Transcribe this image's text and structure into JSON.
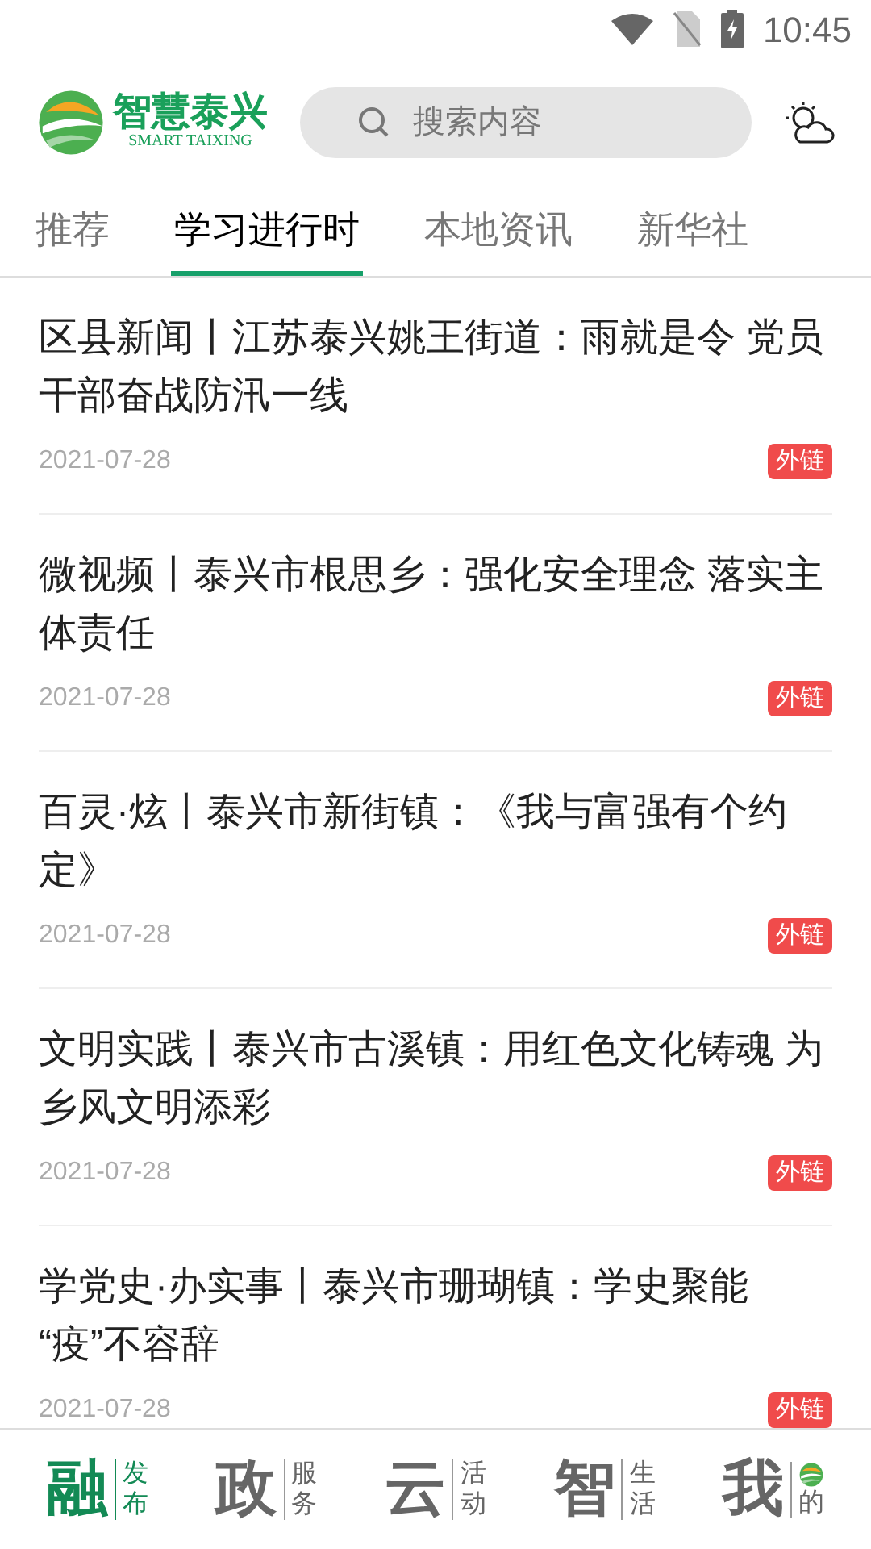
{
  "status_bar": {
    "time": "10:45"
  },
  "header": {
    "logo": {
      "title": "智慧泰兴",
      "subtitle": "SMART TAIXING"
    },
    "search": {
      "placeholder": "搜索内容"
    }
  },
  "tabs": [
    {
      "label": "推荐",
      "selected": false
    },
    {
      "label": "学习进行时",
      "selected": true
    },
    {
      "label": "本地资讯",
      "selected": false
    },
    {
      "label": "新华社",
      "selected": false
    }
  ],
  "articles": [
    {
      "title": "区县新闻丨江苏泰兴姚王街道：雨就是令 党员干部奋战防汛一线",
      "date": "2021-07-28",
      "badge": "外链"
    },
    {
      "title": "微视频丨泰兴市根思乡：强化安全理念 落实主体责任",
      "date": "2021-07-28",
      "badge": "外链"
    },
    {
      "title": "百灵·炫丨泰兴市新街镇：《我与富强有个约定》",
      "date": "2021-07-28",
      "badge": "外链"
    },
    {
      "title": "文明实践丨泰兴市古溪镇：用红色文化铸魂  为乡风文明添彩",
      "date": "2021-07-28",
      "badge": "外链"
    },
    {
      "title": "学党史·办实事丨泰兴市珊瑚镇：学史聚能 “疫”不容辞",
      "date": "2021-07-28",
      "badge": "外链"
    }
  ],
  "bottom_nav": [
    {
      "big": "融",
      "small": "发布",
      "selected": true,
      "kind": "text"
    },
    {
      "big": "政",
      "small": "服务",
      "selected": false,
      "kind": "text"
    },
    {
      "big": "云",
      "small": "活动",
      "selected": false,
      "kind": "text"
    },
    {
      "big": "智",
      "small": "生活",
      "selected": false,
      "kind": "text"
    },
    {
      "big": "我",
      "small": "的",
      "selected": false,
      "kind": "logo"
    }
  ]
}
